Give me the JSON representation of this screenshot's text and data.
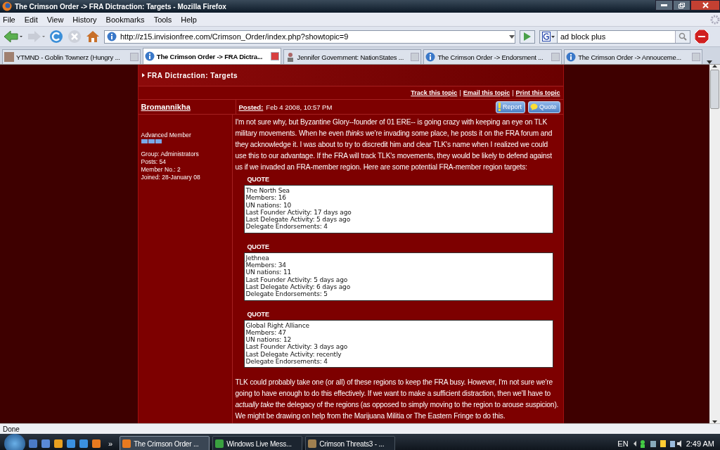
{
  "window": {
    "title": "The Crimson Order -> FRA Dictraction: Targets - Mozilla Firefox"
  },
  "menu": [
    "File",
    "Edit",
    "View",
    "History",
    "Bookmarks",
    "Tools",
    "Help"
  ],
  "navigation": {
    "url": "http://z15.invisionfree.com/Crimson_Order/index.php?showtopic=9",
    "search": "ad block plus"
  },
  "tabs": [
    {
      "label": "YTMND - Goblin Townerz (Hungry ...",
      "selected": false
    },
    {
      "label": "The Crimson Order -> FRA Dictra...",
      "selected": true
    },
    {
      "label": "Jennifer Government: NationStates ...",
      "selected": false
    },
    {
      "label": "The Crimson Order -> Endorsment ...",
      "selected": false
    },
    {
      "label": "The Crimson Order -> Annouceme...",
      "selected": false
    }
  ],
  "topic": {
    "title": "FRA Dictraction: Targets",
    "actions": [
      "Track this topic",
      "Email this topic",
      "Print this topic"
    ],
    "action_separator": "|",
    "post": {
      "author": "Bromannikha",
      "rank": "Advanced Member",
      "details": [
        "Group: Administrators",
        "Posts: 54",
        "Member No.: 2",
        "Joined: 28-January 08"
      ],
      "posted_label": "Posted:",
      "posted_date": "Feb 4 2008, 10:57 PM",
      "buttons": [
        "Report",
        "Quote"
      ],
      "body": [
        {
          "kind": "paragraph",
          "text": "I'm not sure why, but Byzantine Glory--founder of 01 ERE-- is going crazy with keeping an eye on TLK military movements. When he even *thinks* we're invading some place, he posts it on the FRA forum and they acknowledge it. I was about to try to discredit him and clear TLK's name when I realized we could use this to our advantage. If the FRA will track TLK's movements, they would be likely to defend against us if we invaded an FRA-member region. Here are some potential FRA-member region targets:"
        },
        {
          "kind": "quote",
          "label": "QUOTE",
          "lines": [
            "The North Sea",
            "Members: 16",
            "UN nations: 10",
            "Last Founder Activity: 17 days ago",
            "Last Delegate Activity: 5 days ago",
            "Delegate Endorsements: 4"
          ]
        },
        {
          "kind": "quote",
          "label": "QUOTE",
          "lines": [
            "Jethnea",
            "Members: 34",
            "UN nations: 11",
            "Last Founder Activity: 5 days ago",
            "Last Delegate Activity: 6 days ago",
            "Delegate Endorsements: 5"
          ]
        },
        {
          "kind": "quote",
          "label": "QUOTE",
          "lines": [
            "Global Right Alliance",
            "Members: 47",
            "UN nations: 12",
            "Last Founder Activity: 3 days ago",
            "Last Delegate Activity: recently",
            "Delegate Endorsements: 4"
          ]
        },
        {
          "kind": "paragraph",
          "text": "TLK could probably take one (or all) of these regions to keep the FRA busy. However, I'm not sure we're going to have enough to do this effectively. If we want to make a sufficient distraction, then we'll have to *actually take* the delegacy of the regions (as opposed to simply moving to the region to arouse suspicion). We might be drawing on help from the Marijuana Militia or The Eastern Fringe to do this."
        }
      ]
    }
  },
  "status_bar": "Done",
  "taskbar": {
    "overflow": "»",
    "tasks": [
      {
        "label": "The Crimson Order ...",
        "selected": true
      },
      {
        "label": "Windows Live Mess...",
        "selected": false
      },
      {
        "label": "Crimson Threats3 - ...",
        "selected": false
      }
    ],
    "language": "EN",
    "time": "2:49 AM"
  }
}
